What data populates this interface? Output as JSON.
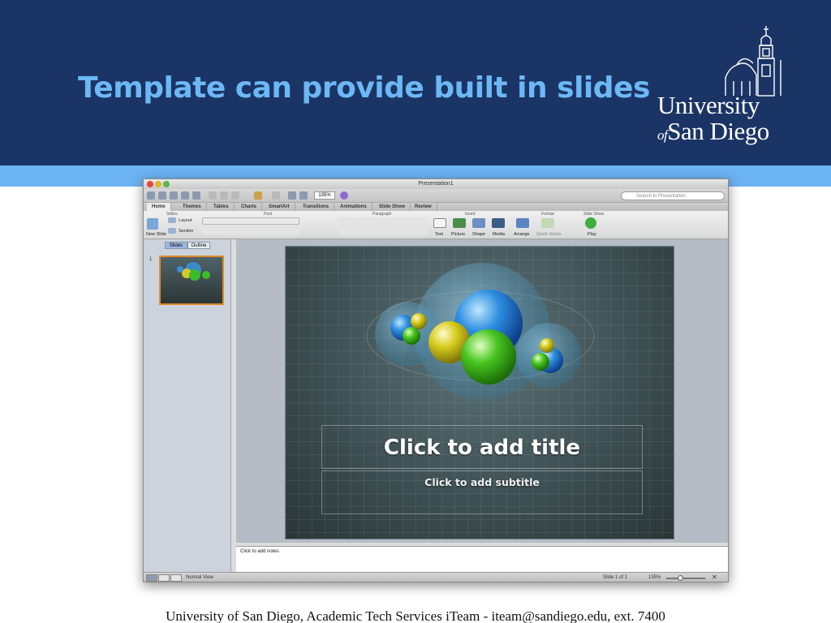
{
  "slide": {
    "title": "Template can provide built in slides",
    "logo_line1": "University",
    "logo_of": "of",
    "logo_line2": "San Diego",
    "footer": "University of San Diego, Academic Tech Services iTeam - iteam@sandiego.edu, ext. 7400"
  },
  "app": {
    "window_title": "Presentation1",
    "zoom": "135%",
    "search_placeholder": "Search in Presentation",
    "tabs": [
      "Home",
      "Themes",
      "Tables",
      "Charts",
      "SmartArt",
      "Transitions",
      "Animations",
      "Slide Show",
      "Review"
    ],
    "ribbon_groups": {
      "slides": "Slides",
      "font": "Font",
      "paragraph": "Paragraph",
      "insert": "Insert",
      "format": "Format",
      "slideshow": "Slide Show"
    },
    "ribbon_buttons": {
      "new_slide": "New Slide",
      "layout": "Layout",
      "section": "Section",
      "text": "Text",
      "picture": "Picture",
      "shape": "Shape",
      "media": "Media",
      "arrange": "Arrange",
      "quick_styles": "Quick Styles",
      "play": "Play"
    },
    "pane_tabs": {
      "slides": "Slides",
      "outline": "Outline"
    },
    "thumb_number": "1",
    "placeholder_title": "Click to add title",
    "placeholder_subtitle": "Click to add subtitle",
    "notes_placeholder": "Click to add notes",
    "status": {
      "view": "Normal View",
      "slide_of": "Slide 1 of 1",
      "zoom": "135%"
    }
  }
}
